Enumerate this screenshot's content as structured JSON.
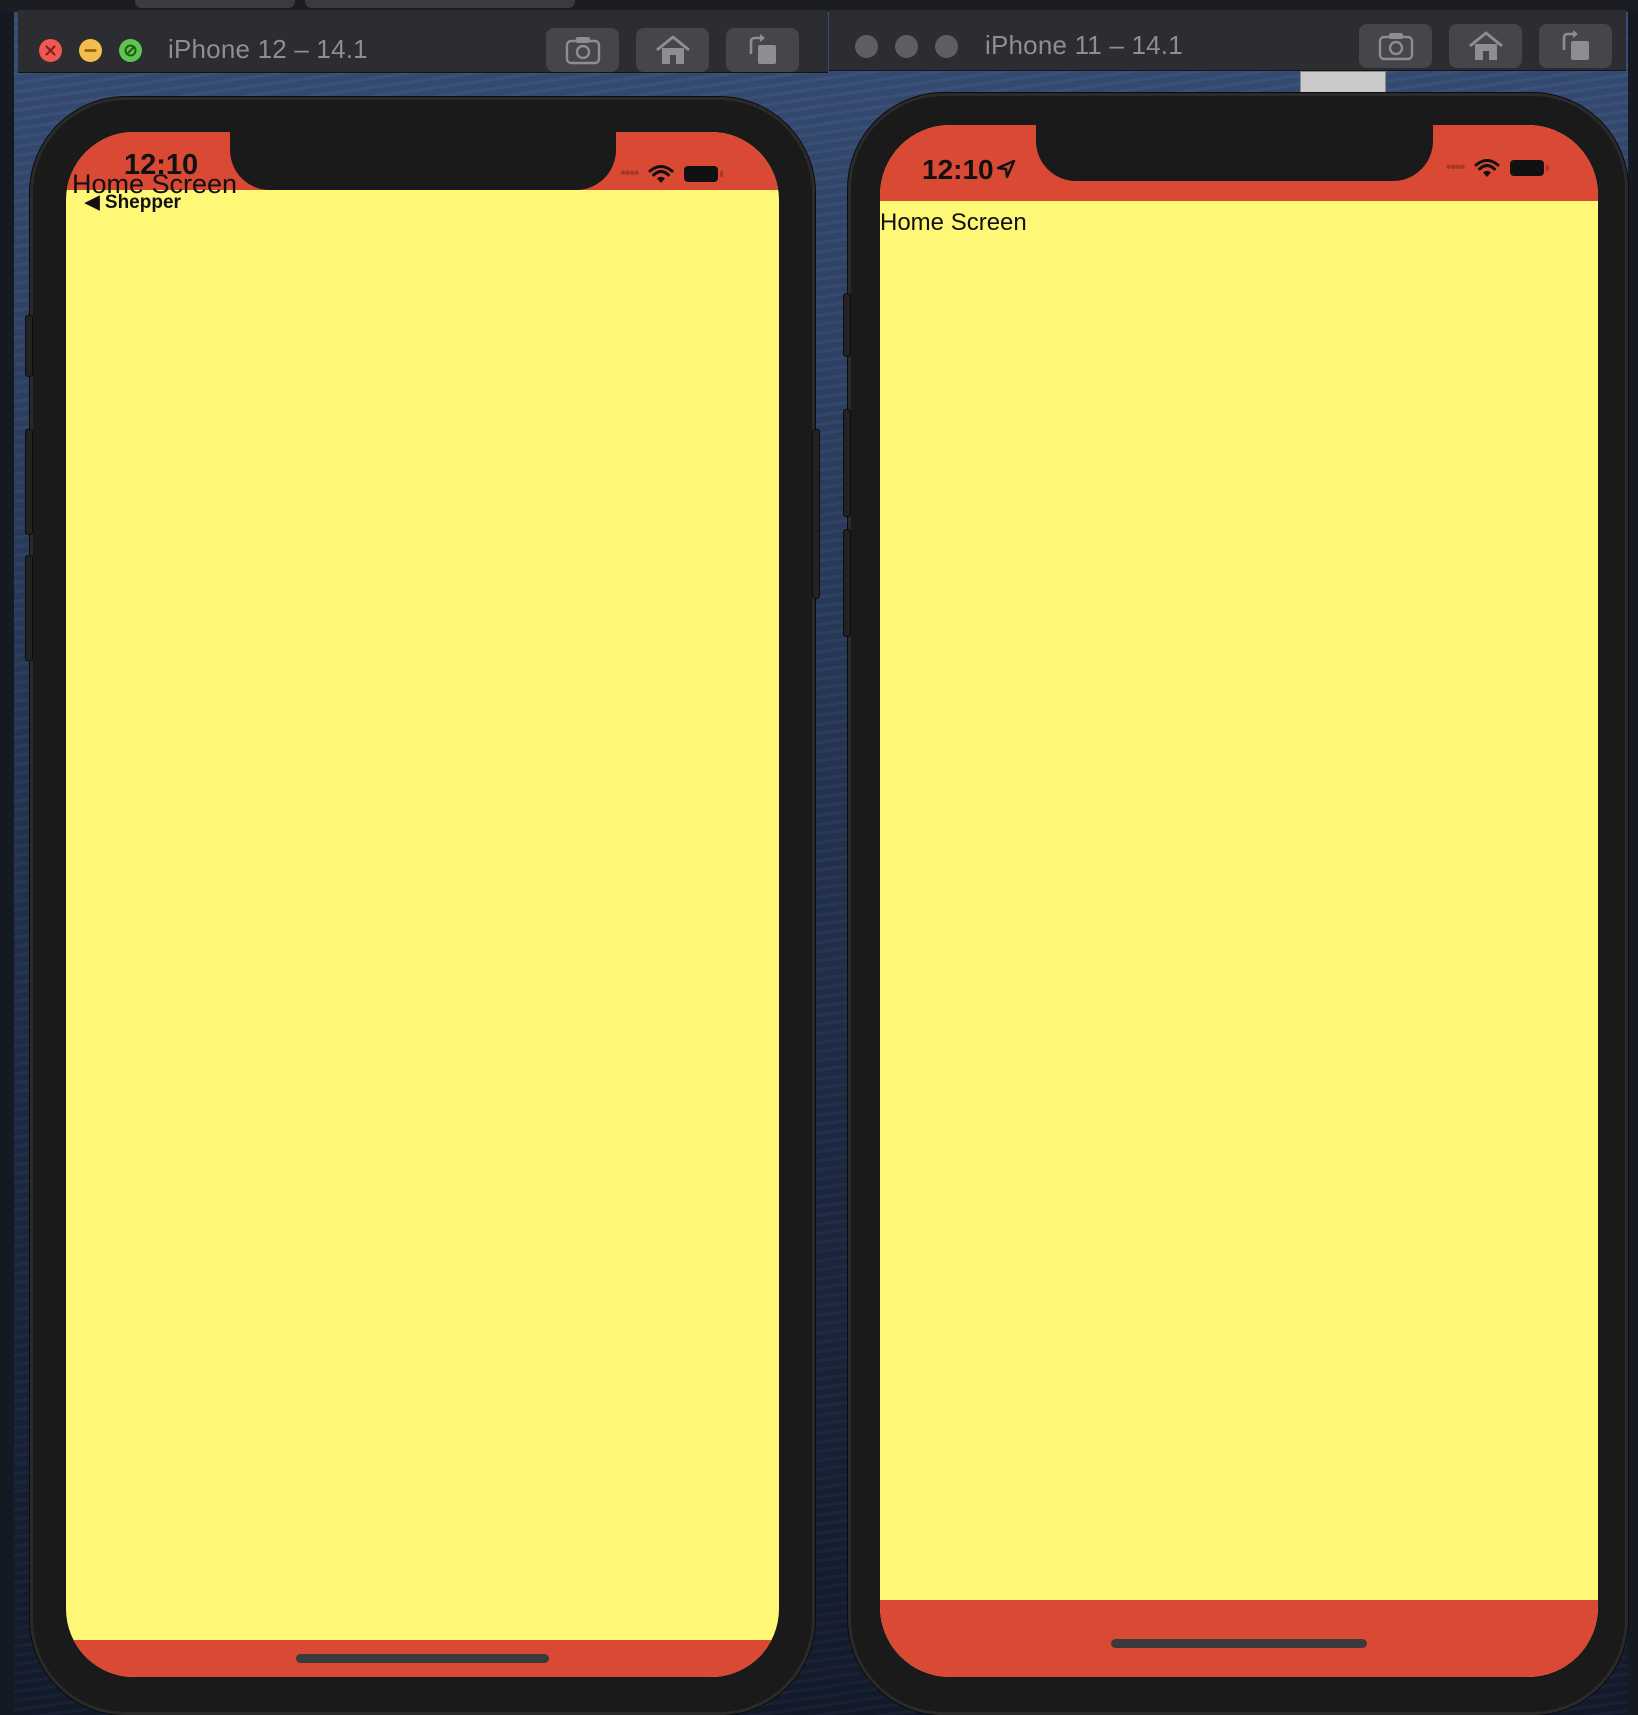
{
  "colors": {
    "status_bar_red": "#d94933",
    "screen_yellow": "#fff877",
    "window_chrome": "#2c2d31",
    "bezel": "#1a1a1a"
  },
  "left_simulator": {
    "title": "iPhone 12 – 14.1",
    "toolbar": {
      "screenshot_icon": "camera-icon",
      "home_icon": "home-icon",
      "rotate_icon": "rotate-icon"
    },
    "status_bar": {
      "time": "12:10"
    },
    "app": {
      "title": "Home Screen",
      "back_label": "◀ Shepper"
    }
  },
  "right_simulator": {
    "title": "iPhone 11 – 14.1",
    "toolbar": {
      "screenshot_icon": "camera-icon",
      "home_icon": "home-icon",
      "rotate_icon": "rotate-icon"
    },
    "status_bar": {
      "time": "12:10"
    },
    "app": {
      "title": "Home Screen"
    }
  }
}
